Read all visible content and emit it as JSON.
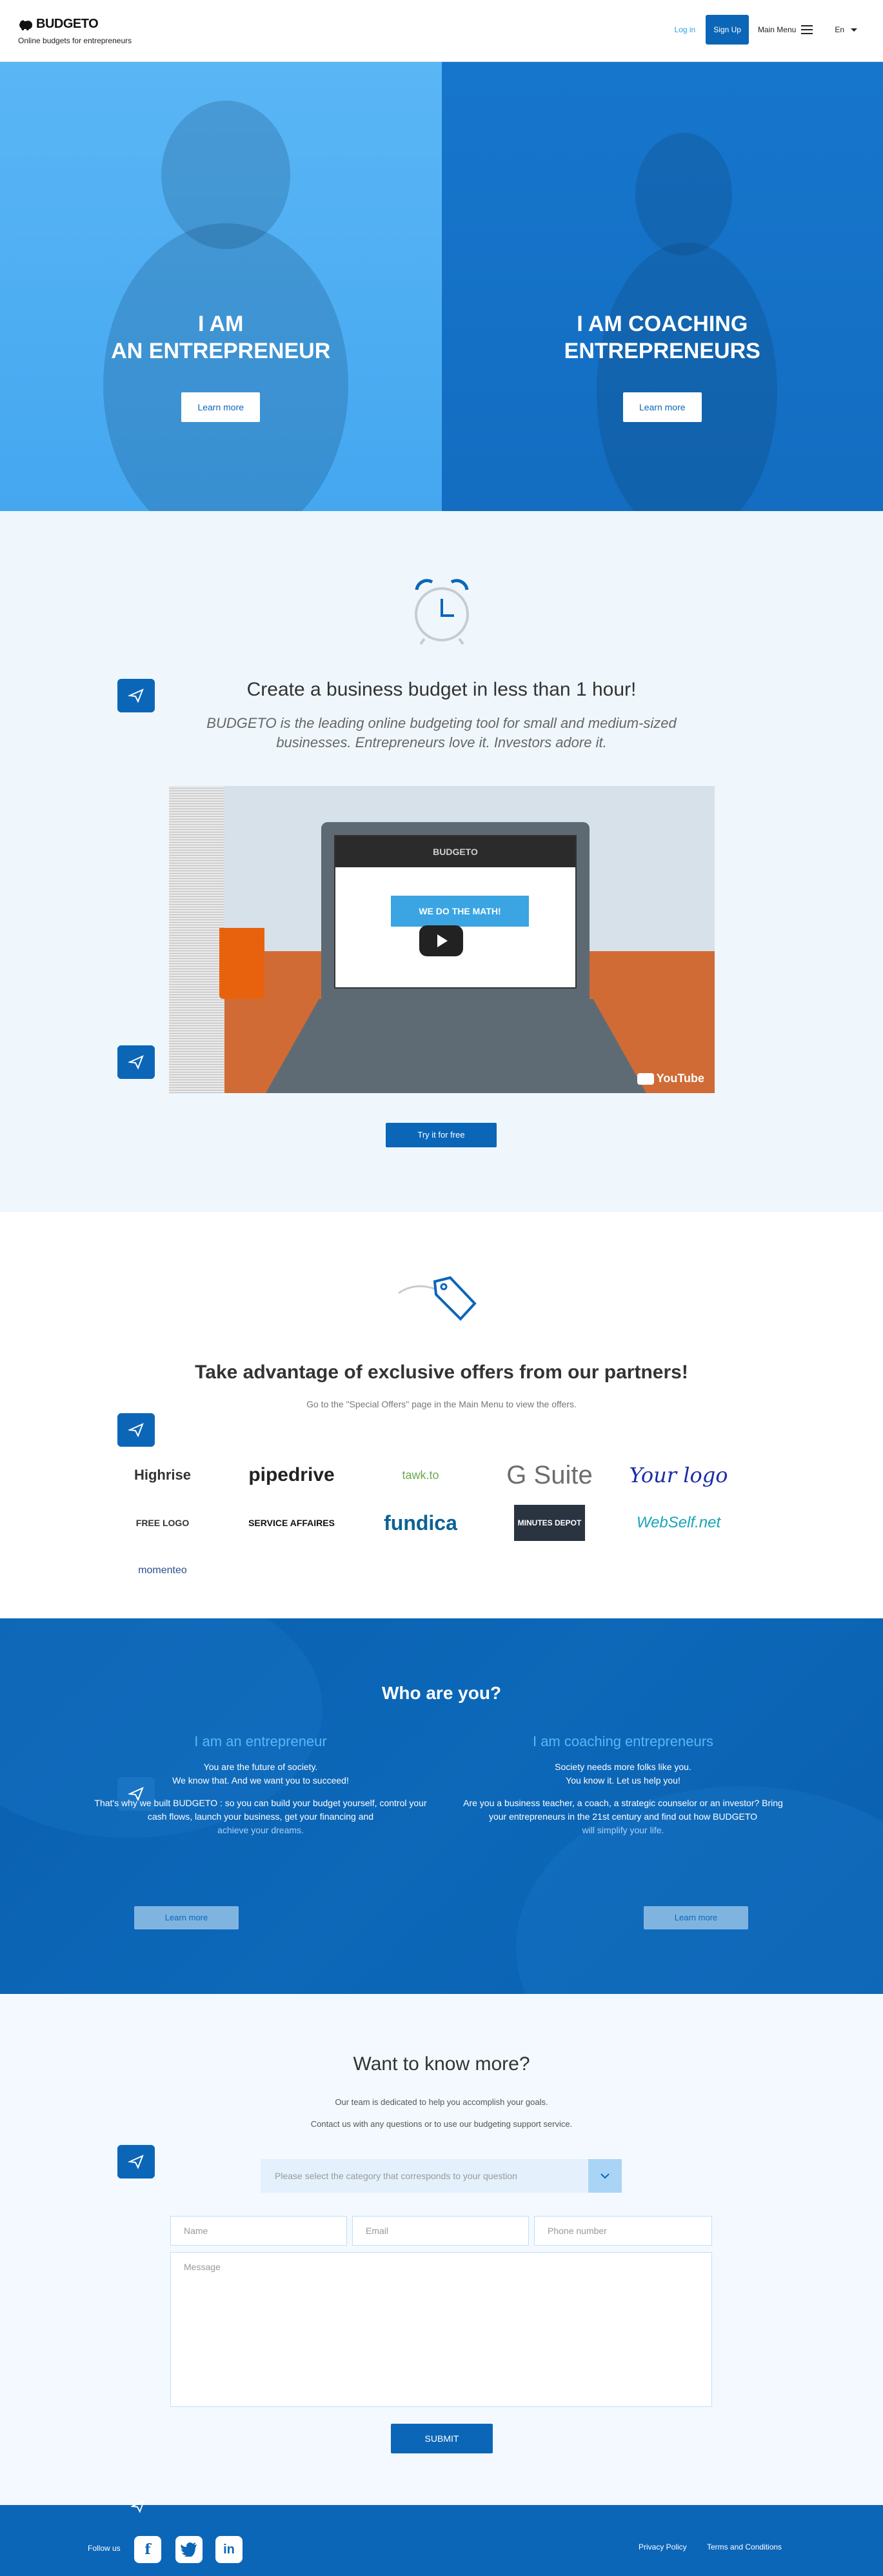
{
  "header": {
    "logo": "BUDGETO",
    "tagline": "Online budgets for entrepreneurs",
    "login_label": "Log in",
    "signup_label": "Sign Up",
    "menu_label": "Main Menu",
    "language": "En"
  },
  "hero": {
    "left": {
      "title_line1": "I AM",
      "title_line2": "AN ENTREPRENEUR",
      "button": "Learn more"
    },
    "right": {
      "title_line1": "I AM COACHING",
      "title_line2": "ENTREPRENEURS",
      "button": "Learn more"
    }
  },
  "budget_section": {
    "title": "Create a business budget in less than 1 hour!",
    "subtitle": "BUDGETO is the leading online budgeting tool for small and medium-sized businesses. Entrepreneurs love it. Investors adore it.",
    "video": {
      "brand": "BUDGETO",
      "banner": "WE DO THE MATH!",
      "provider": "YouTube"
    },
    "cta": "Try it for free"
  },
  "partners_section": {
    "title": "Take advantage of exclusive offers from our partners!",
    "subtitle": "Go to the \"Special Offers\" page in the Main Menu to view the offers.",
    "partners": [
      "Highrise",
      "pipedrive",
      "tawk.to",
      "G Suite",
      "Your logo",
      "FREE LOGO",
      "SERVICE AFFAIRES",
      "fundica",
      "MINUTES DEPOT",
      "WebSelf.net",
      "momenteo"
    ]
  },
  "who_section": {
    "title": "Who are you?",
    "entrepreneur": {
      "heading": "I am an entrepreneur",
      "line1": "You are the future of society.",
      "line2": "We know that. And we want you to succeed!",
      "line3": "That's why we built BUDGETO : so you can build your budget yourself, control your cash flows, launch your business, get your financing and",
      "line4": "achieve your dreams.",
      "button": "Learn more"
    },
    "coach": {
      "heading": "I am coaching entrepreneurs",
      "line1": "Society needs more folks like you.",
      "line2": "You know it. Let us help you!",
      "line3": "Are you a business teacher, a coach, a strategic counselor or an investor? Bring your entrepreneurs in the 21st century and find out how BUDGETO",
      "line4": "will simplify your life.",
      "button": "Learn more"
    }
  },
  "contact_section": {
    "title": "Want to know more?",
    "line1": "Our team is dedicated to help you accomplish your goals.",
    "line2": "Contact us with any questions or to use our budgeting support service.",
    "select_placeholder": "Please select the category that corresponds to your question",
    "name_placeholder": "Name",
    "email_placeholder": "Email",
    "phone_placeholder": "Phone number",
    "message_placeholder": "Message",
    "submit": "SUBMIT"
  },
  "footer": {
    "follow": "Follow us",
    "privacy": "Privacy Policy",
    "terms": "Terms and Conditions"
  }
}
